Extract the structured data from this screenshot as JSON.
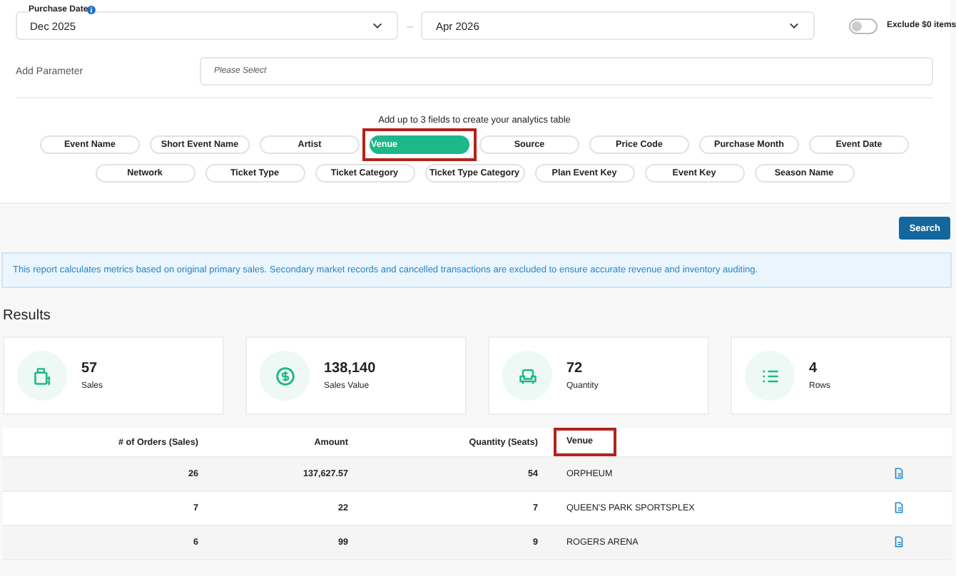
{
  "filters": {
    "date_label": "Purchase Date",
    "date_from": "Dec 2025",
    "separator": "–",
    "date_to": "Apr 2026",
    "exclude_zero": {
      "label": "Exclude $0 items",
      "on": false
    },
    "parameter_label": "Add Parameter",
    "parameter_placeholder": "Please Select"
  },
  "fields": {
    "hint": "Add up to 3 fields to create your analytics table",
    "chips": [
      {
        "label": "Event Name",
        "selected": false,
        "highlighted": false
      },
      {
        "label": "Short Event Name",
        "selected": false,
        "highlighted": false
      },
      {
        "label": "Artist",
        "selected": false,
        "highlighted": false
      },
      {
        "label": "Venue",
        "selected": true,
        "highlighted": true
      },
      {
        "label": "Source",
        "selected": false,
        "highlighted": false
      },
      {
        "label": "Price Code",
        "selected": false,
        "highlighted": false
      },
      {
        "label": "Purchase Month",
        "selected": false,
        "highlighted": false
      },
      {
        "label": "Event Date",
        "selected": false,
        "highlighted": false
      },
      {
        "label": "Network",
        "selected": false,
        "highlighted": false
      },
      {
        "label": "Ticket Type",
        "selected": false,
        "highlighted": false
      },
      {
        "label": "Ticket Category",
        "selected": false,
        "highlighted": false
      },
      {
        "label": "Ticket Type Category",
        "selected": false,
        "highlighted": false
      },
      {
        "label": "Plan Event Key",
        "selected": false,
        "highlighted": false
      },
      {
        "label": "Event Key",
        "selected": false,
        "highlighted": false
      },
      {
        "label": "Season Name",
        "selected": false,
        "highlighted": false
      }
    ]
  },
  "search_button": "Search",
  "notice": "This report calculates metrics based on original primary sales. Secondary market records and cancelled transactions are excluded to ensure accurate revenue and inventory auditing.",
  "results_title": "Results",
  "stats": [
    {
      "kind": "sales",
      "value": "57",
      "label": "Sales"
    },
    {
      "kind": "money",
      "value": "138,140",
      "label": "Sales Value"
    },
    {
      "kind": "seat",
      "value": "72",
      "label": "Quantity"
    },
    {
      "kind": "list",
      "value": "4",
      "label": "Rows"
    }
  ],
  "table": {
    "columns": [
      {
        "label": "# of Orders (Sales)",
        "highlighted": false
      },
      {
        "label": "Amount",
        "highlighted": false
      },
      {
        "label": "Quantity (Seats)",
        "highlighted": false
      },
      {
        "label": "Venue",
        "highlighted": true
      }
    ],
    "rows": [
      [
        "26",
        "137,627.57",
        "54",
        "ORPHEUM"
      ],
      [
        "7",
        "22",
        "7",
        "QUEEN'S PARK SPORTSPLEX"
      ],
      [
        "6",
        "99",
        "9",
        "ROGERS ARENA"
      ]
    ]
  }
}
